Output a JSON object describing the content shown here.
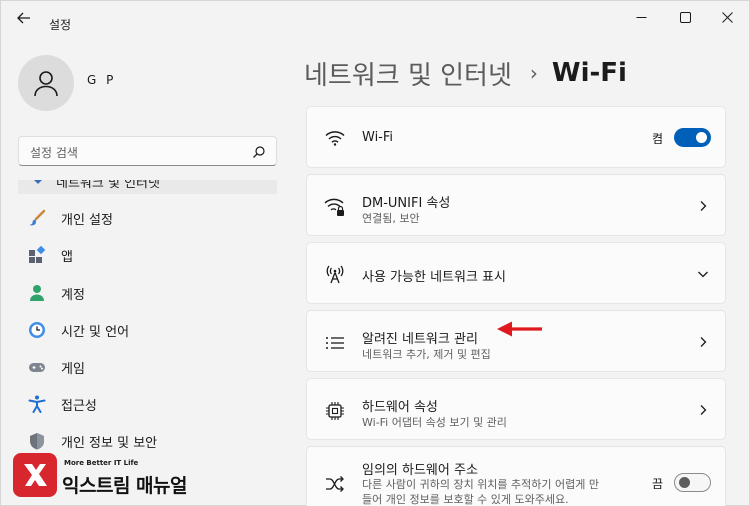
{
  "window": {
    "title": "설정"
  },
  "profile": {
    "name": "G P"
  },
  "search": {
    "placeholder": "설정 검색"
  },
  "sidebar": {
    "partial_item": "네트워크 및 인터넷",
    "items": [
      {
        "label": "개인 설정",
        "icon": "brush-icon"
      },
      {
        "label": "앱",
        "icon": "apps-icon"
      },
      {
        "label": "계정",
        "icon": "account-icon"
      },
      {
        "label": "시간 및 언어",
        "icon": "clock-globe-icon"
      },
      {
        "label": "게임",
        "icon": "gamepad-icon"
      },
      {
        "label": "접근성",
        "icon": "accessibility-icon"
      },
      {
        "label": "개인 정보 및 보안",
        "icon": "shield-icon"
      }
    ]
  },
  "breadcrumb": {
    "parent": "네트워크 및 인터넷",
    "separator": "›",
    "current": "Wi-Fi"
  },
  "cards": {
    "wifi": {
      "title": "Wi-Fi",
      "toggle_label": "켬",
      "toggle_on": true
    },
    "properties": {
      "title": "DM-UNIFI 속성",
      "subtitle": "연결됨, 보안"
    },
    "available": {
      "title": "사용 가능한 네트워크 표시"
    },
    "known": {
      "title": "알려진 네트워크 관리",
      "subtitle": "네트워크 추가, 제거 및 편집"
    },
    "hardware": {
      "title": "하드웨어 속성",
      "subtitle": "Wi-Fi 어댑터 속성 보기 및 관리"
    },
    "random": {
      "title": "임의의 하드웨어 주소",
      "subtitle_line1": "다른 사람이 귀하의 장치 위치를 추적하기 어렵게 만",
      "subtitle_line2": "들어 개인 정보를 보호할 수 있게 도와주세요.",
      "toggle_label": "끔",
      "toggle_on": false
    }
  },
  "watermark": {
    "tagline": "More Better IT Life",
    "name": "익스트림 매뉴얼"
  },
  "colors": {
    "accent": "#005fb8",
    "annotation_arrow": "#e0191e",
    "logo_red": "#d7262e"
  }
}
